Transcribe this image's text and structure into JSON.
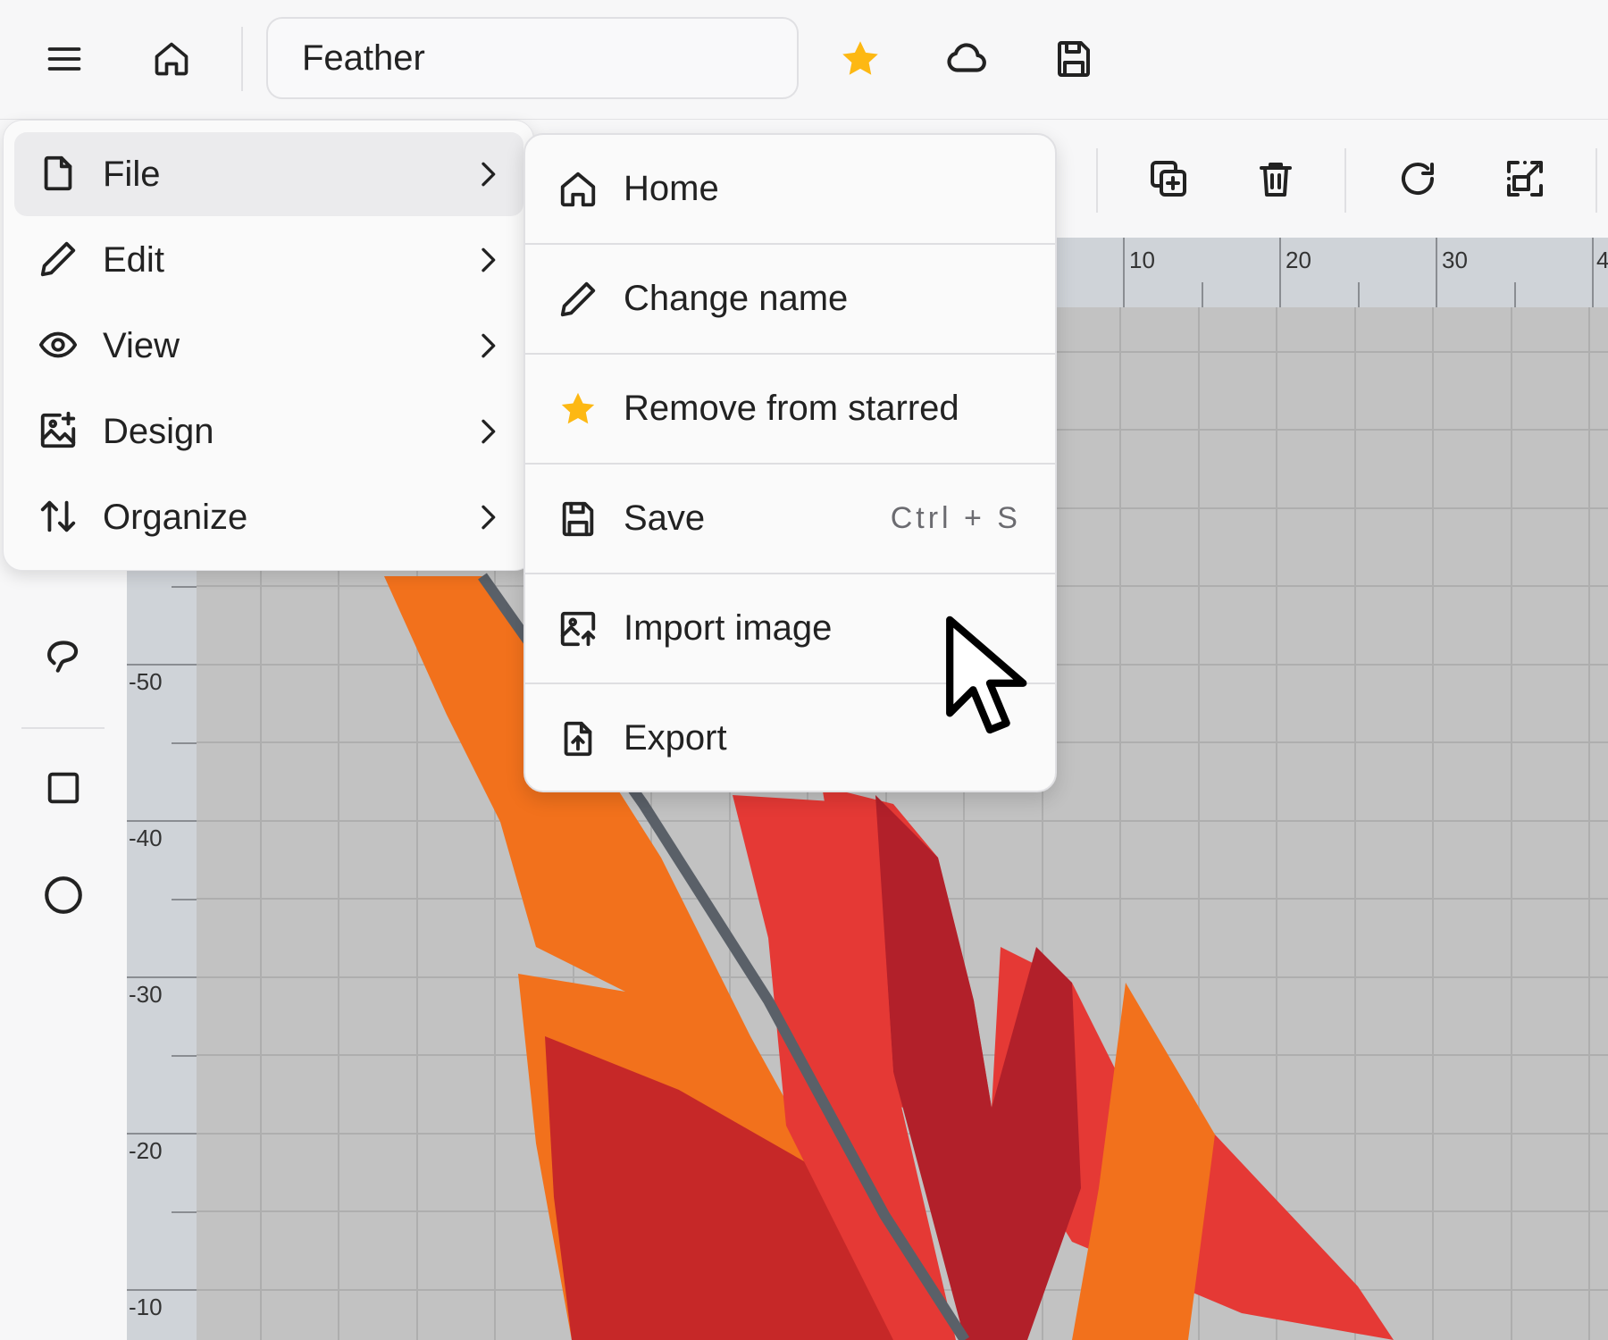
{
  "header": {
    "document_name": "Feather",
    "icons": [
      "menu-icon",
      "home-icon",
      "star-icon",
      "cloud-icon",
      "save-icon"
    ]
  },
  "toolbar": {
    "icons": [
      "duplicate-icon",
      "trash-icon",
      "rotate-icon",
      "fit-icon"
    ]
  },
  "rulers": {
    "top": [
      "10",
      "20",
      "30",
      "4"
    ],
    "left": [
      "-50",
      "-40",
      "-30",
      "-20",
      "-10"
    ]
  },
  "main_menu": {
    "items": [
      {
        "label": "File",
        "icon": "file-icon"
      },
      {
        "label": "Edit",
        "icon": "pencil-icon"
      },
      {
        "label": "View",
        "icon": "eye-icon"
      },
      {
        "label": "Design",
        "icon": "image-plus-icon"
      },
      {
        "label": "Organize",
        "icon": "sort-arrows-icon"
      }
    ]
  },
  "file_menu": {
    "items": [
      {
        "label": "Home",
        "icon": "home-icon"
      },
      {
        "label": "Change name",
        "icon": "pencil-icon"
      },
      {
        "label": "Remove from starred",
        "icon": "star-icon"
      },
      {
        "label": "Save",
        "icon": "save-icon",
        "shortcut": "Ctrl + S"
      },
      {
        "label": "Import image",
        "icon": "image-upload-icon"
      },
      {
        "label": "Export",
        "icon": "file-export-icon"
      }
    ]
  },
  "colors": {
    "star": "#fdb813",
    "feather_orange": "#f2711c",
    "feather_red": "#e53935",
    "feather_dark_red": "#b2202a",
    "quill": "#5a6068",
    "grid_bg": "#c2c2c2",
    "ruler_bg": "#cfd3d8"
  }
}
